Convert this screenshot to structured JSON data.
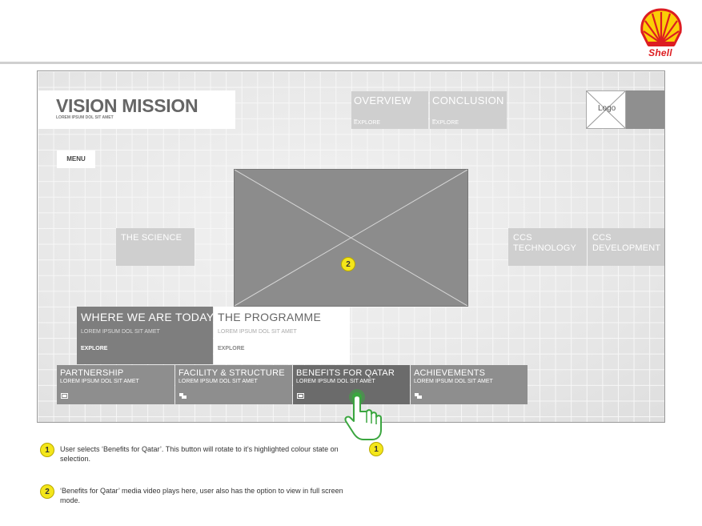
{
  "brand": {
    "name": "Shell",
    "colors": {
      "red": "#dd1d21",
      "yellow": "#fbce07"
    }
  },
  "header": {
    "title": "VISION MISSION",
    "subtitle": "LOREM IPSUM DOL SIT AMET"
  },
  "top_nav": [
    {
      "label": "OVERVIEW",
      "dash": "_",
      "action": "EXPLORE"
    },
    {
      "label": "CONCLUSION",
      "dash": "_",
      "action": "EXPLORE"
    }
  ],
  "logo": {
    "label": "Logo"
  },
  "menu": {
    "label": "MENU"
  },
  "side_tiles": {
    "science": "THE SCIENCE",
    "ccs_technology": [
      "CCS",
      "TECHNOLOGY"
    ],
    "ccs_development": [
      "CCS",
      "DEVELOPMENT"
    ]
  },
  "media": {
    "marker": "2"
  },
  "feature_tiles": [
    {
      "title": "WHERE WE ARE TODAY",
      "subtitle": "LOREM IPSUM DOL SIT AMET",
      "dash": "_",
      "action": "EXPLORE"
    },
    {
      "title": "THE PROGRAMME",
      "subtitle": "LOREM IPSUM DOL SIT AMET",
      "dash": "_",
      "action": "EXPLORE"
    }
  ],
  "bottom_nav": [
    {
      "title": "PARTNERSHIP",
      "subtitle": "LOREM IPSUM DOL SIT AMET",
      "icon": "video-icon"
    },
    {
      "title": "FACILITY & STRUCTURE",
      "subtitle": "LOREM IPSUM DOL SIT AMET",
      "icon": "chat-icon"
    },
    {
      "title": "BENEFITS FOR QATAR",
      "subtitle": "LOREM IPSUM DOL SIT AMET",
      "icon": "video-icon",
      "selected": true
    },
    {
      "title": "ACHIEVEMENTS",
      "subtitle": "LOREM IPSUM DOL SIT AMET",
      "icon": "chat-icon"
    }
  ],
  "annotations": [
    {
      "marker": "1",
      "text": "User selects ‘Benefits for Qatar’. This button will rotate to it’s highlighted colour state on selection."
    },
    {
      "marker": "2",
      "text": "‘Benefits for Qatar’ media video plays here, user also has the option to view in full screen mode."
    }
  ],
  "hand_marker": "1",
  "colors": {
    "annotation_yellow": "#f4e61a",
    "tap_green": "#3aa63f",
    "selected_tile": "#6b6b6b",
    "tile": "#8e8e8e"
  }
}
